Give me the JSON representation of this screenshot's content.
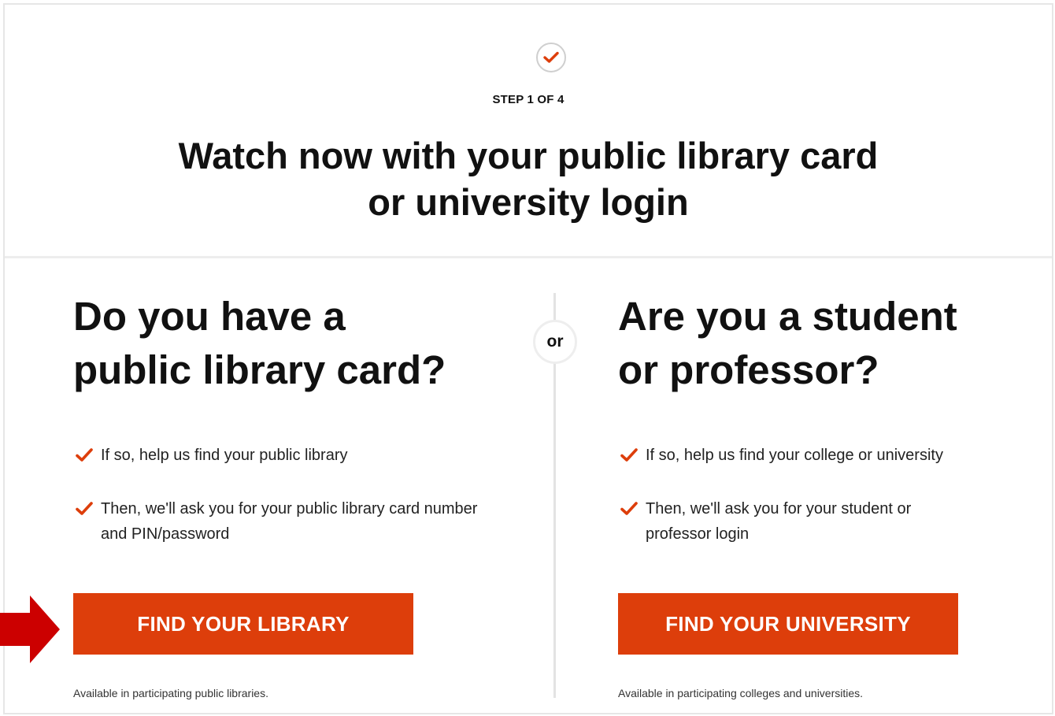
{
  "colors": {
    "accent": "#dd3e0b",
    "annotation_arrow": "#cc0000",
    "divider": "#e3e3e3"
  },
  "header": {
    "step_icon": "check-icon",
    "step_label": "STEP 1 OF 4",
    "title_line1": "Watch now with your public library card",
    "title_line2": "or university login"
  },
  "separator": {
    "label": "or"
  },
  "library": {
    "heading_line1": "Do you have a",
    "heading_line2": "public library card?",
    "items": [
      "If so, help us find your public library",
      "Then, we'll ask you for your public library card number and PIN/password"
    ],
    "button_label": "FIND YOUR LIBRARY",
    "note": "Available in participating public libraries."
  },
  "university": {
    "heading_line1": "Are you a student",
    "heading_line2": "or professor?",
    "items": [
      "If so, help us find your college or university",
      "Then, we'll ask you for your student or professor login"
    ],
    "button_label": "FIND YOUR UNIVERSITY",
    "note": "Available in participating colleges and universities."
  },
  "annotation": {
    "icon": "right-arrow-icon"
  }
}
